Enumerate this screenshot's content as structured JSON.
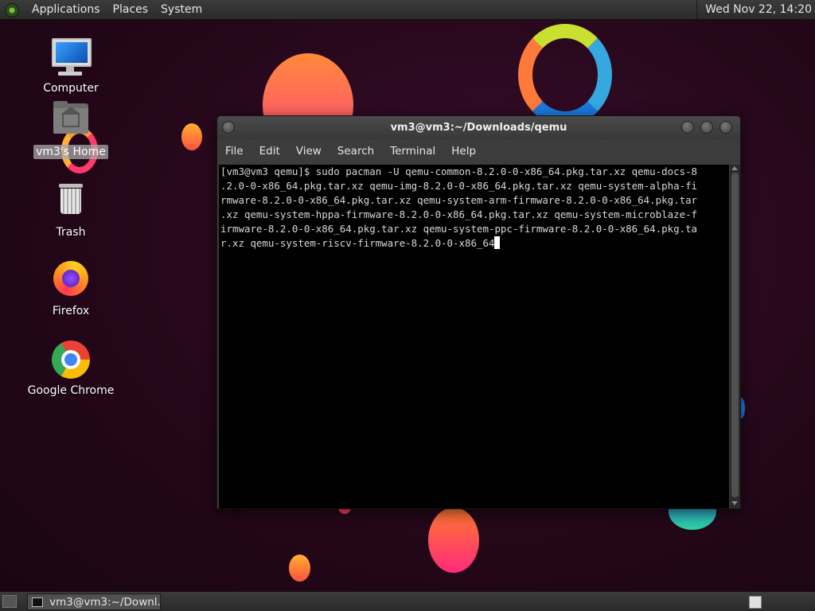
{
  "top_panel": {
    "menus": [
      "Applications",
      "Places",
      "System"
    ],
    "clock": "Wed Nov 22, 14:20"
  },
  "desktop_icons": [
    {
      "label": "Computer",
      "icon": "computer-icon"
    },
    {
      "label": "vm3's Home",
      "icon": "home-folder-icon",
      "selected": true
    },
    {
      "label": "Trash",
      "icon": "trash-icon"
    },
    {
      "label": "Firefox",
      "icon": "firefox-icon"
    },
    {
      "label": "Google Chrome",
      "icon": "chrome-icon"
    }
  ],
  "terminal": {
    "title": "vm3@vm3:~/Downloads/qemu",
    "menu": [
      "File",
      "Edit",
      "View",
      "Search",
      "Terminal",
      "Help"
    ],
    "lines": [
      "[vm3@vm3 qemu]$ sudo pacman -U qemu-common-8.2.0-0-x86_64.pkg.tar.xz qemu-docs-8",
      ".2.0-0-x86_64.pkg.tar.xz qemu-img-8.2.0-0-x86_64.pkg.tar.xz qemu-system-alpha-fi",
      "rmware-8.2.0-0-x86_64.pkg.tar.xz qemu-system-arm-firmware-8.2.0-0-x86_64.pkg.tar",
      ".xz qemu-system-hppa-firmware-8.2.0-0-x86_64.pkg.tar.xz qemu-system-microblaze-f",
      "irmware-8.2.0-0-x86_64.pkg.tar.xz qemu-system-ppc-firmware-8.2.0-0-x86_64.pkg.ta",
      "r.xz qemu-system-riscv-firmware-8.2.0-0-x86_64"
    ]
  },
  "bottom_panel": {
    "task_label": "vm3@vm3:~/Downl..."
  },
  "colors": {
    "panel": "#2f2f2f",
    "terminal_bg": "#000000",
    "terminal_fg": "#d8d8d8",
    "wallpaper": "#240719"
  }
}
